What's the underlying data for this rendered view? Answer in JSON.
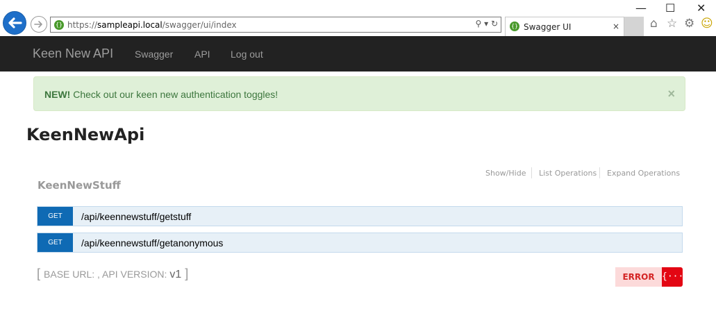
{
  "browser": {
    "url_prefix": "https://",
    "url_host": "sampleapi.local",
    "url_path": "/swagger/ui/index",
    "tab_title": "Swagger UI",
    "tab_close": "×",
    "minimize": "—",
    "maximize": "☐",
    "close": "✕",
    "address_tools": "⚲ ▾ ↻",
    "favicon_glyph": "{}"
  },
  "navbar": {
    "brand": "Keen New API",
    "links": [
      "Swagger",
      "API",
      "Log out"
    ]
  },
  "alert": {
    "strong": "NEW!",
    "message": " Check out our keen new authentication toggles!",
    "close": "×"
  },
  "api": {
    "title": "KeenNewApi",
    "resource": {
      "name": "KeenNewStuff",
      "links": [
        "Show/Hide",
        "List Operations",
        "Expand Operations"
      ],
      "operations": [
        {
          "method": "GET",
          "path": "/api/keennewstuff/getstuff"
        },
        {
          "method": "GET",
          "path": "/api/keennewstuff/getanonymous"
        }
      ]
    },
    "footer": {
      "open": "[ ",
      "base_url_label": "BASE URL: ",
      "separator": ", API VERSION: ",
      "version": "v1",
      "close": " ]"
    },
    "validator": {
      "label": "ERROR",
      "badge": "{···}"
    }
  },
  "colors": {
    "navbar_bg": "#222222",
    "alert_bg": "#dff0d8",
    "alert_text": "#3c763d",
    "get_verb": "#0f6ab4",
    "get_row_bg": "#e7f0f7",
    "error_bg": "#fcdada",
    "error_badge": "#e30613"
  }
}
